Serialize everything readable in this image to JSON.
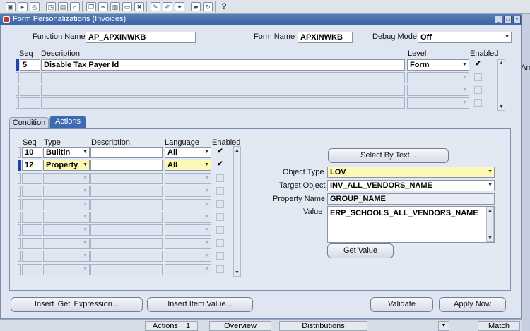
{
  "window": {
    "title": "Form Personalizations (Invoices)",
    "accent": "#3c63a3"
  },
  "toolbar": {
    "icons": [
      "save-icon",
      "navigate-icon",
      "zoom-icon",
      "open-icon",
      "print-icon",
      "find-icon",
      "copy-icon",
      "cut-icon",
      "paste-icon",
      "clear-icon",
      "delete-icon",
      "edit-icon",
      "translate-icon",
      "attachment-icon",
      "folder-icon",
      "refresh-icon",
      "help-icon"
    ],
    "help_glyph": "?"
  },
  "header": {
    "function_name_label": "Function Name",
    "function_name_value": "AP_APXINWKB",
    "form_name_label": "Form Name",
    "form_name_value": "APXINWKB",
    "debug_mode_label": "Debug Mode",
    "debug_mode_value": "Off"
  },
  "rules": {
    "seq_header": "Seq",
    "description_header": "Description",
    "level_header": "Level",
    "enabled_header": "Enabled",
    "rows": [
      {
        "seq": "5",
        "description": "Disable Tax Payer Id",
        "level": "Form",
        "enabled": "✔"
      },
      {
        "seq": "",
        "description": "",
        "level": "",
        "enabled": ""
      },
      {
        "seq": "",
        "description": "",
        "level": "",
        "enabled": ""
      },
      {
        "seq": "",
        "description": "",
        "level": "",
        "enabled": ""
      }
    ]
  },
  "tabs": {
    "condition": "Condition",
    "actions": "Actions"
  },
  "actions": {
    "seq_header": "Seq",
    "type_header": "Type",
    "description_header": "Description",
    "language_header": "Language",
    "enabled_header": "Enabled",
    "rows": [
      {
        "seq": "10",
        "type": "Builtin",
        "description": "",
        "language": "All",
        "enabled": "✔"
      },
      {
        "seq": "12",
        "type": "Property",
        "description": "",
        "language": "All",
        "enabled": "✔"
      },
      {
        "seq": "",
        "type": "",
        "description": "",
        "language": "",
        "enabled": ""
      },
      {
        "seq": "",
        "type": "",
        "description": "",
        "language": "",
        "enabled": ""
      },
      {
        "seq": "",
        "type": "",
        "description": "",
        "language": "",
        "enabled": ""
      },
      {
        "seq": "",
        "type": "",
        "description": "",
        "language": "",
        "enabled": ""
      },
      {
        "seq": "",
        "type": "",
        "description": "",
        "language": "",
        "enabled": ""
      },
      {
        "seq": "",
        "type": "",
        "description": "",
        "language": "",
        "enabled": ""
      },
      {
        "seq": "",
        "type": "",
        "description": "",
        "language": "",
        "enabled": ""
      },
      {
        "seq": "",
        "type": "",
        "description": "",
        "language": "",
        "enabled": ""
      }
    ]
  },
  "properties": {
    "select_by_text_label": "Select By Text...",
    "object_type_label": "Object Type",
    "object_type_value": "LOV",
    "target_object_label": "Target Object",
    "target_object_value": "INV_ALL_VENDORS_NAME",
    "property_name_label": "Property Name",
    "property_name_value": "GROUP_NAME",
    "value_label": "Value",
    "value_value": "ERP_SCHOOLS_ALL_VENDORS_NAME",
    "get_value_label": "Get Value"
  },
  "buttons": {
    "insert_get_expression": "Insert 'Get' Expression...",
    "insert_item_value": "Insert Item Value...",
    "validate": "Validate",
    "apply_now": "Apply Now"
  },
  "background_form": {
    "actions_label": "Actions",
    "actions_count": "1",
    "overview": "Overview",
    "distributions": "Distributions",
    "match": "Match",
    "amount_fragment": "Amo"
  }
}
